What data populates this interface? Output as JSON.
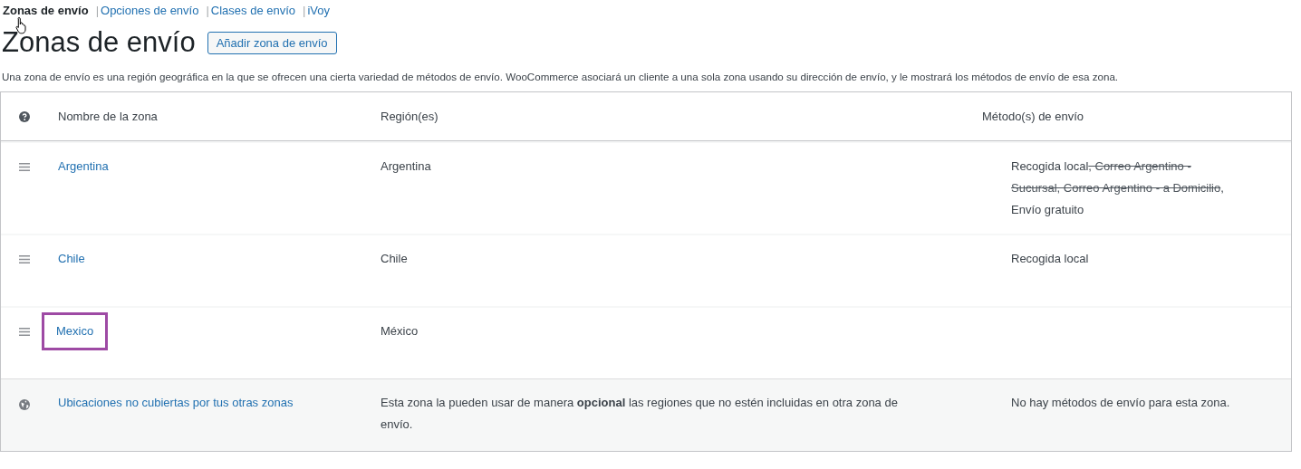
{
  "nav": [
    {
      "label": "Zonas de envío",
      "selected": true
    },
    {
      "prefix": "|",
      "label": "Opciones de envío",
      "selected": false
    },
    {
      "prefix": "|",
      "label": "Clases de envío",
      "selected": false
    },
    {
      "prefix": "|",
      "label": "iVoy",
      "selected": false
    }
  ],
  "heading": {
    "title": "Zonas de envío",
    "button": "Añadir zona de envío"
  },
  "description": "Una zona de envío es una región geográfica en la que se ofrecen una cierta variedad de métodos de envío. WooCommerce asociará un cliente a una sola zona usando su dirección de envío, y le mostrará los métodos de envío de esa zona.",
  "table": {
    "columns": [
      "Nombre de la zona",
      "Región(es)",
      "Método(s) de envío"
    ],
    "rows": [
      {
        "kind": "zone",
        "name": "Argentina",
        "region": "Argentina",
        "highlighted": false,
        "methods": [
          {
            "text": "Recogida local",
            "disabled": false
          },
          {
            "text": ", Correo Argentino -",
            "disabled": true
          },
          {
            "text": "Sucursal, Correo Argentino - a Domicilio",
            "disabled": true
          },
          {
            "text": ",",
            "disabled": false
          },
          {
            "text": "Envío gratuito",
            "disabled": false
          }
        ]
      },
      {
        "kind": "zone",
        "name": "Chile",
        "region": "Chile",
        "highlighted": false,
        "methods": [
          {
            "text": "Recogida local",
            "disabled": false
          }
        ]
      },
      {
        "kind": "zone",
        "name": "Mexico",
        "region": "México",
        "highlighted": true
      },
      {
        "kind": "fallback",
        "name": "Ubicaciones no cubiertas por tus otras zonas",
        "region": "Esta zona la pueden usar de manera **opcional** las regiones que no estén incluidas en otra zona de envío.",
        "highlighted": false,
        "methods": [
          {
            "text": "No hay métodos de envío para esta zona.",
            "disabled": false
          }
        ]
      }
    ]
  }
}
